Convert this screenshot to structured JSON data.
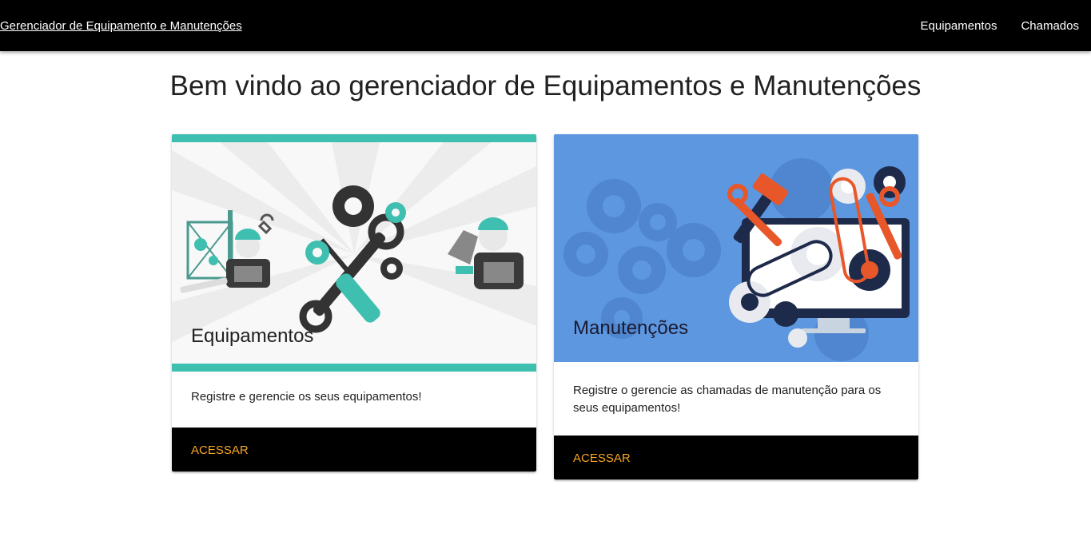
{
  "navbar": {
    "brand": "Gerenciador de Equipamento e Manutenções",
    "links": [
      "Equipamentos",
      "Chamados"
    ]
  },
  "page": {
    "title": "Bem vindo ao gerenciador de Equipamentos e Manutenções"
  },
  "cards": [
    {
      "title": "Equipamentos",
      "description": "Registre e gerencie os seus equipamentos!",
      "action": "ACESSAR"
    },
    {
      "title": "Manutenções",
      "description": "Registre o gerencie as chamadas de manutenção para os seus equipamentos!",
      "action": "ACESSAR"
    }
  ],
  "colors": {
    "navbar": "#000000",
    "accent_teal": "#3fbfb0",
    "action_text": "#f5a623",
    "maintenance_bg": "#5c97e0"
  },
  "icons": [
    "gear-icon",
    "wrench-icon",
    "screwdriver-icon",
    "worker-icon",
    "monitor-icon",
    "hammer-icon"
  ]
}
